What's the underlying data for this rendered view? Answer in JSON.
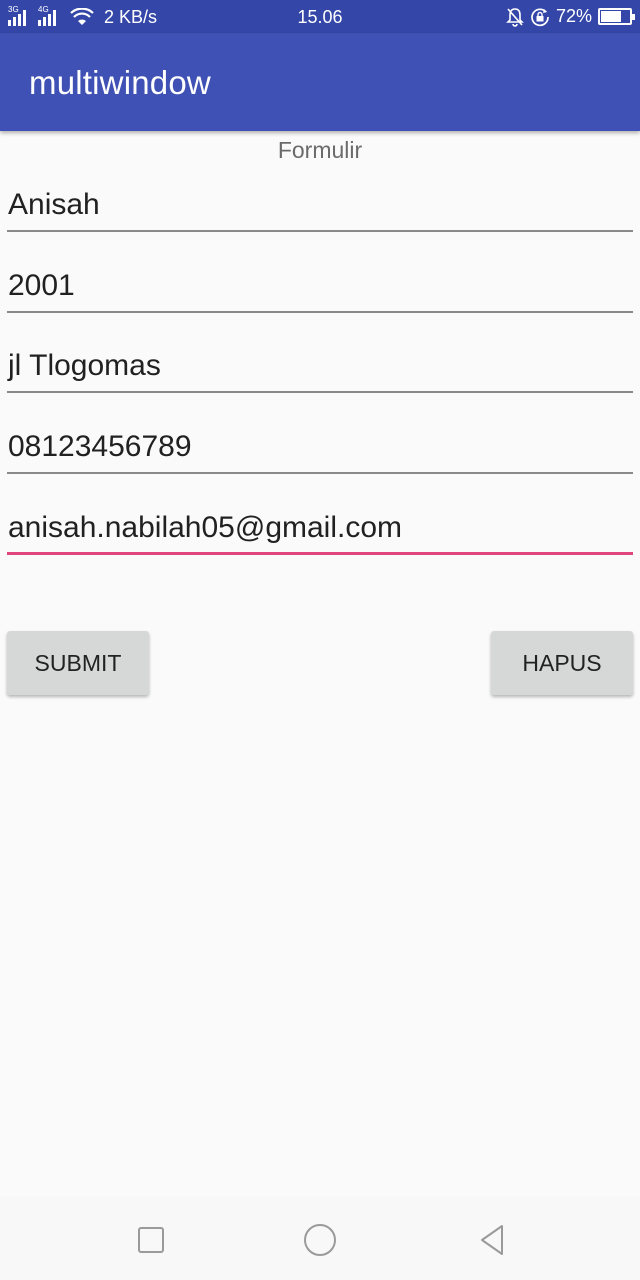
{
  "status_bar": {
    "network_tags": [
      "3G",
      "4G"
    ],
    "speed": "2 KB/s",
    "time": "15.06",
    "battery_percent": "72%",
    "battery_level": 0.72,
    "icons": [
      "signal-icon",
      "wifi-icon",
      "bell-muted-icon",
      "lock-rotation-icon",
      "battery-icon"
    ]
  },
  "app_bar": {
    "title": "multiwindow",
    "color": "#3f51b5"
  },
  "form": {
    "heading": "Formulir",
    "fields": [
      {
        "value": "Anisah"
      },
      {
        "value": "2001"
      },
      {
        "value": "jl Tlogomas"
      },
      {
        "value": "08123456789"
      },
      {
        "value": "anisah.nabilah05@gmail.com",
        "focused": true
      }
    ],
    "accent_color": "#e0457b"
  },
  "buttons": {
    "submit": "SUBMIT",
    "delete": "HAPUS"
  },
  "nav_bar": {
    "icons": [
      "recent-apps-icon",
      "home-icon",
      "back-icon"
    ]
  }
}
